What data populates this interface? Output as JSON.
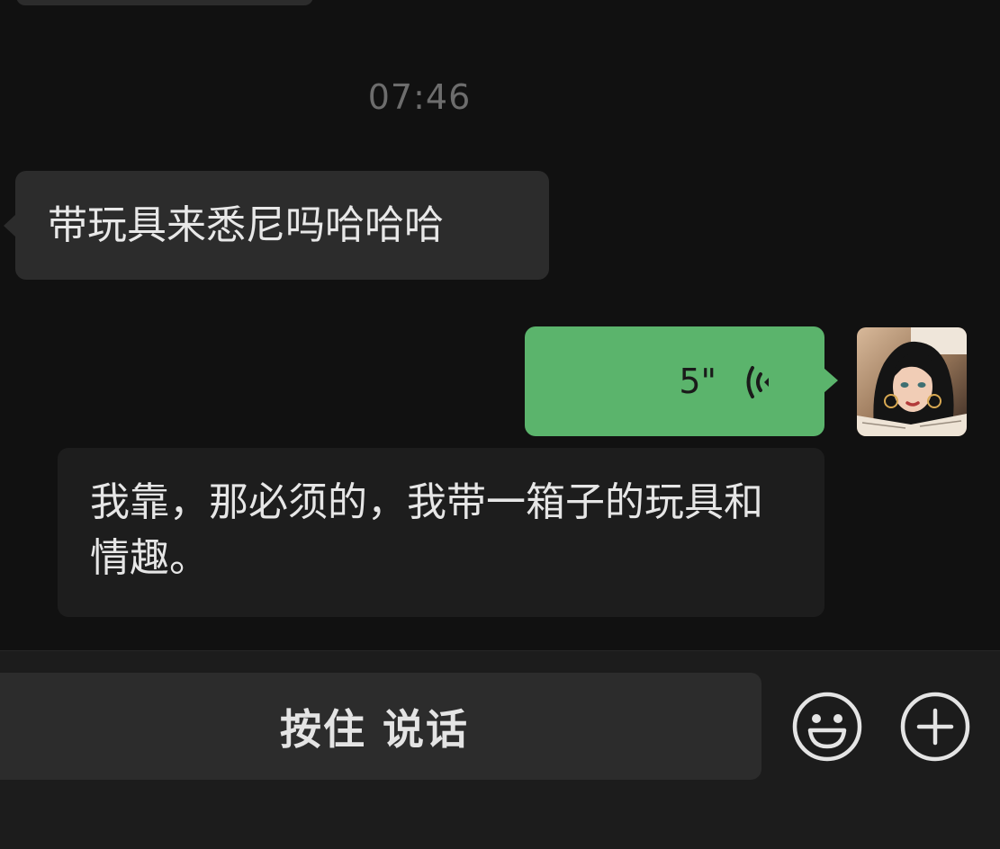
{
  "chat": {
    "timestamp": "07:46",
    "messages": [
      {
        "side": "incoming",
        "text": "带玩具来悉尼吗哈哈哈"
      },
      {
        "side": "outgoing",
        "type": "voice",
        "duration": "5\"",
        "icon": "voice-wave-icon"
      },
      {
        "side": "incoming",
        "text": "我靠，那必须的，我带一箱子的玩具和情趣。"
      }
    ]
  },
  "input_bar": {
    "talk_label": "按住 说话",
    "emoji_icon": "emoji-smile-icon",
    "plus_icon": "plus-circle-icon"
  },
  "colors": {
    "background": "#111111",
    "incoming_bubble": "#2c2c2c",
    "outgoing_bubble": "#5bb46c",
    "bottom_bar": "#1c1c1c"
  }
}
